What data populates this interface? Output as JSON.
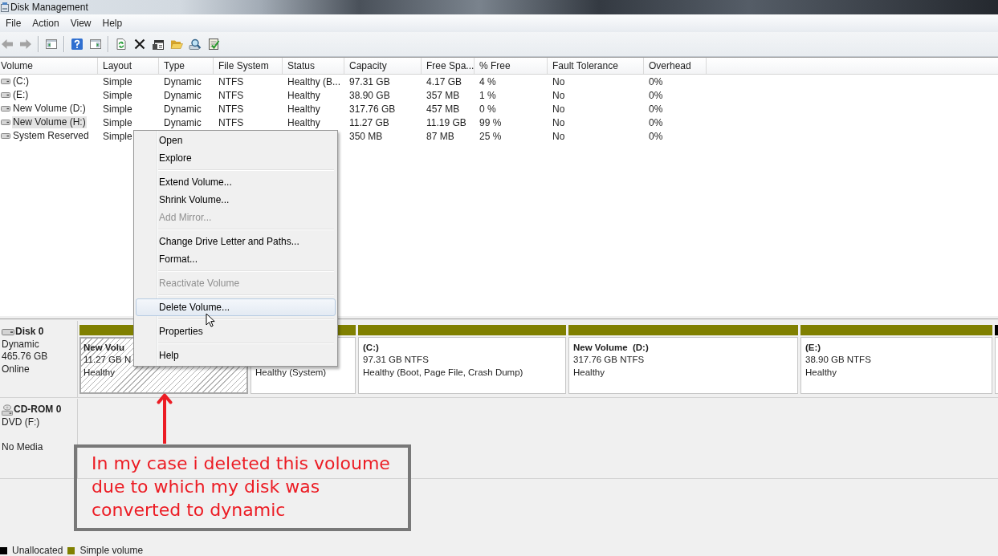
{
  "window": {
    "title": "Disk Management"
  },
  "menu_bar": [
    "File",
    "Action",
    "View",
    "Help"
  ],
  "toolbar": [
    {
      "items": [
        {
          "kind": "back",
          "disabled": true
        },
        {
          "kind": "forward",
          "disabled": true
        }
      ]
    },
    {
      "items": [
        {
          "kind": "show_tree",
          "disabled": false
        }
      ]
    },
    {
      "items": [
        {
          "kind": "help",
          "disabled": false
        },
        {
          "kind": "show_actions",
          "disabled": false
        }
      ]
    },
    {
      "items": [
        {
          "kind": "refresh",
          "disabled": false
        },
        {
          "kind": "delete",
          "disabled": false
        },
        {
          "kind": "properties",
          "disabled": false
        },
        {
          "kind": "folder",
          "disabled": false
        },
        {
          "kind": "search",
          "disabled": false
        },
        {
          "kind": "checklist",
          "disabled": false
        }
      ]
    }
  ],
  "volume_table": {
    "columns": [
      "Volume",
      "Layout",
      "Type",
      "File System",
      "Status",
      "Capacity",
      "Free Spa...",
      "% Free",
      "Fault Tolerance",
      "Overhead"
    ],
    "rows": [
      {
        "selected": false,
        "volume": "(C:)",
        "layout": "Simple",
        "type": "Dynamic",
        "file_system": "NTFS",
        "status": "Healthy (B...",
        "capacity": "97.31 GB",
        "column_7": "4.17 GB",
        "percent_free": "4 %",
        "fault_tolerance": "No",
        "overhead": "0%"
      },
      {
        "selected": false,
        "volume": "(E:)",
        "layout": "Simple",
        "type": "Dynamic",
        "file_system": "NTFS",
        "status": "Healthy",
        "capacity": "38.90 GB",
        "column_7": "357 MB",
        "percent_free": "1 %",
        "fault_tolerance": "No",
        "overhead": "0%"
      },
      {
        "selected": false,
        "volume": "New Volume (D:)",
        "layout": "Simple",
        "type": "Dynamic",
        "file_system": "NTFS",
        "status": "Healthy",
        "capacity": "317.76 GB",
        "column_7": "457 MB",
        "percent_free": "0 %",
        "fault_tolerance": "No",
        "overhead": "0%"
      },
      {
        "selected": true,
        "volume": "New Volume (H:)",
        "layout": "Simple",
        "type": "Dynamic",
        "file_system": "NTFS",
        "status": "Healthy",
        "capacity": "11.27 GB",
        "column_7": "11.19 GB",
        "percent_free": "99 %",
        "fault_tolerance": "No",
        "overhead": "0%"
      },
      {
        "selected": false,
        "volume": "System Reserved",
        "layout": "Simple",
        "capacity": "350 MB",
        "column_7": "87 MB",
        "percent_free": "25 %",
        "fault_tolerance": "No",
        "overhead": "0%"
      }
    ]
  },
  "disks": [
    {
      "kind": "disk",
      "name": "Disk 0",
      "type": "Dynamic",
      "size": "465.76 GB",
      "status": "Online",
      "partitions": [
        {
          "kind": "simple",
          "selected": true,
          "title": "New Volu",
          "detail": "11.27 GB N",
          "status": "Healthy"
        },
        {
          "kind": "simple",
          "selected": false,
          "status": "Healthy (System)"
        },
        {
          "kind": "simple",
          "selected": false,
          "title": "(C:)",
          "detail": "97.31 GB NTFS",
          "status": "Healthy (Boot, Page File, Crash Dump)"
        },
        {
          "kind": "simple",
          "selected": false,
          "title": "New Volume  (D:)",
          "detail": "317.76 GB NTFS",
          "status": "Healthy"
        },
        {
          "kind": "simple",
          "selected": false,
          "title": "(E:)",
          "detail": "38.90 GB NTFS",
          "status": "Healthy"
        },
        {
          "kind": "unallocated",
          "selected": false
        }
      ]
    },
    {
      "kind": "cdrom",
      "name": "CD-ROM 0",
      "type": "DVD (F:)",
      "status": "No Media"
    }
  ],
  "legend": [
    {
      "label": "Unallocated",
      "color": "#000000"
    },
    {
      "label": "Simple volume",
      "color": "#808000"
    }
  ],
  "context_menu": {
    "groups": [
      {
        "items": [
          {
            "label": "Open",
            "disabled": false,
            "selected": false
          },
          {
            "label": "Explore",
            "disabled": false,
            "selected": false
          }
        ]
      },
      {
        "items": [
          {
            "label": "Extend Volume...",
            "disabled": false,
            "selected": false
          },
          {
            "label": "Shrink Volume...",
            "disabled": false,
            "selected": false
          },
          {
            "label": "Add Mirror...",
            "disabled": true,
            "selected": false
          }
        ]
      },
      {
        "items": [
          {
            "label": "Change Drive Letter and Paths...",
            "disabled": false,
            "selected": false
          },
          {
            "label": "Format...",
            "disabled": false,
            "selected": false
          }
        ]
      },
      {
        "items": [
          {
            "label": "Reactivate Volume",
            "disabled": true,
            "selected": false
          }
        ]
      },
      {
        "items": [
          {
            "label": "Delete Volume...",
            "disabled": false,
            "selected": true
          }
        ]
      },
      {
        "items": [
          {
            "label": "Properties",
            "disabled": false,
            "selected": false
          }
        ]
      },
      {
        "items": [
          {
            "label": "Help",
            "disabled": false,
            "selected": false
          }
        ]
      }
    ]
  },
  "annotation": {
    "text": "In my case i deleted this voloume\ndue to which my disk was\nconverted to dynamic"
  }
}
